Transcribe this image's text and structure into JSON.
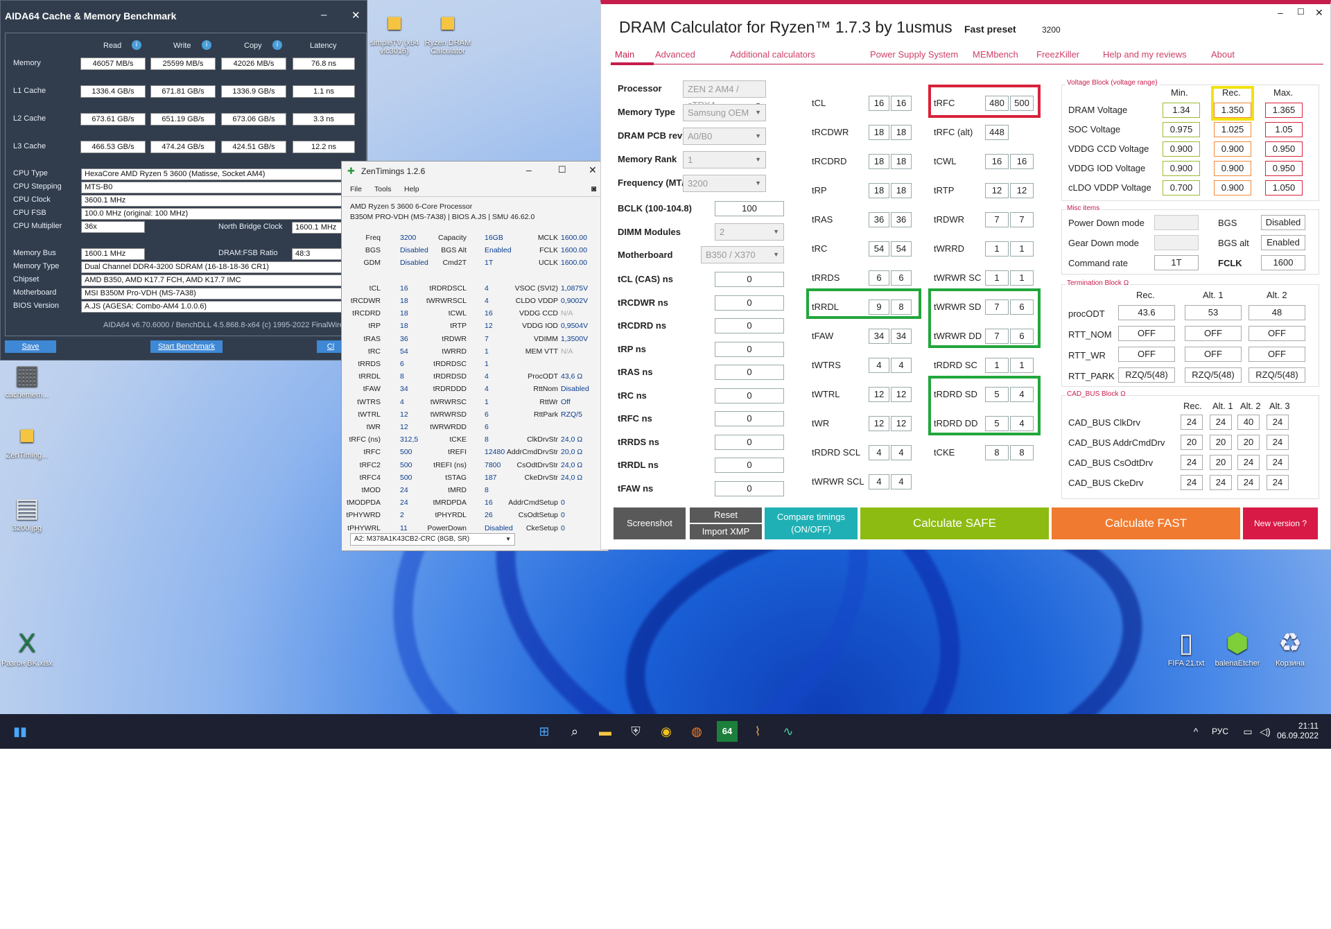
{
  "desktop": {
    "icons_top": [
      {
        "label": "simpleTV (x64 vlc3016)"
      },
      {
        "label": "Ryzen DRAM Calculator"
      }
    ],
    "icons_left": [
      {
        "label": "cachemem..."
      },
      {
        "label": "ZenTiming..."
      },
      {
        "label": "3200.jpg"
      },
      {
        "label": "Разгон BK.xlsx"
      }
    ],
    "icons_right": [
      {
        "label": "FIFA 21.txt"
      },
      {
        "label": "balenaEtcher"
      },
      {
        "label": "Корзина"
      }
    ]
  },
  "taskbar": {
    "lang": "РУС",
    "time": "21:11",
    "date": "06.09.2022",
    "icons": [
      "start-icon",
      "search-icon",
      "explorer-icon",
      "wot-icon",
      "chrome-icon",
      "firefox-icon",
      "aida64-icon",
      "sound-wave-icon",
      "monitor-app-icon"
    ],
    "aida_badge": "64"
  },
  "aida": {
    "title": "AIDA64 Cache & Memory Benchmark",
    "cols": [
      "Read",
      "Write",
      "Copy",
      "Latency"
    ],
    "rows": [
      {
        "label": "Memory",
        "values": [
          "46057 MB/s",
          "25599 MB/s",
          "42026 MB/s",
          "76.8 ns"
        ]
      },
      {
        "label": "L1 Cache",
        "values": [
          "1336.4 GB/s",
          "671.81 GB/s",
          "1336.9 GB/s",
          "1.1 ns"
        ]
      },
      {
        "label": "L2 Cache",
        "values": [
          "673.61 GB/s",
          "651.19 GB/s",
          "673.06 GB/s",
          "3.3 ns"
        ]
      },
      {
        "label": "L3 Cache",
        "values": [
          "466.53 GB/s",
          "474.24 GB/s",
          "424.51 GB/s",
          "12.2 ns"
        ]
      }
    ],
    "info": [
      {
        "label": "CPU Type",
        "value": "HexaCore AMD Ryzen 5 3600  (Matisse, Socket AM4)"
      },
      {
        "label": "CPU Stepping",
        "value": "MTS-B0"
      },
      {
        "label": "CPU Clock",
        "value": "3600.1 MHz"
      },
      {
        "label": "CPU FSB",
        "value": "100.0 MHz  (original: 100 MHz)"
      },
      {
        "label": "CPU Multiplier",
        "value": "36x"
      }
    ],
    "nb_clock_label": "North Bridge Clock",
    "nb_clock_value": "1600.1 MHz",
    "mem_info": [
      {
        "label": "Memory Bus",
        "value": "1600.1 MHz"
      },
      {
        "label": "Memory Type",
        "value": "Dual Channel DDR4-3200 SDRAM  (16-18-18-36 CR1)"
      },
      {
        "label": "Chipset",
        "value": "AMD B350, AMD K17.7 FCH, AMD K17.7 IMC"
      },
      {
        "label": "Motherboard",
        "value": "MSI B350M Pro-VDH (MS-7A38)"
      },
      {
        "label": "BIOS Version",
        "value": "A.JS  (AGESA: Combo-AM4 1.0.0.6)"
      }
    ],
    "fsb_ratio_label": "DRAM:FSB Ratio",
    "fsb_ratio_value": "48:3",
    "footer": "AIDA64 v6.70.6000 / BenchDLL 4.5.868.8-x64  (c) 1995-2022 FinalWire",
    "btn_save": "Save",
    "btn_start": "Start Benchmark",
    "btn_close": "Cl"
  },
  "zen": {
    "title": "ZenTimings 1.2.6",
    "menu": [
      "File",
      "Tools",
      "Help"
    ],
    "cpu": "AMD Ryzen 5 3600 6-Core Processor",
    "board": "B350M PRO-VDH (MS-7A38) | BIOS A.JS | SMU 46.62.0",
    "col1": [
      [
        "Freq",
        "3200"
      ],
      [
        "BGS",
        "Disabled"
      ],
      [
        "GDM",
        "Disabled"
      ],
      [
        "",
        ""
      ],
      [
        "tCL",
        "16"
      ],
      [
        "tRCDWR",
        "18"
      ],
      [
        "tRCDRD",
        "18"
      ],
      [
        "tRP",
        "18"
      ],
      [
        "tRAS",
        "36"
      ],
      [
        "tRC",
        "54"
      ],
      [
        "tRRDS",
        "6"
      ],
      [
        "tRRDL",
        "8"
      ],
      [
        "tFAW",
        "34"
      ],
      [
        "tWTRS",
        "4"
      ],
      [
        "tWTRL",
        "12"
      ],
      [
        "tWR",
        "12"
      ],
      [
        "tRFC (ns)",
        "312,5"
      ],
      [
        "tRFC",
        "500"
      ],
      [
        "tRFC2",
        "500"
      ],
      [
        "tRFC4",
        "500"
      ],
      [
        "tMOD",
        "24"
      ],
      [
        "tMODPDA",
        "24"
      ],
      [
        "tPHYWRD",
        "2"
      ],
      [
        "tPHYWRL",
        "11"
      ]
    ],
    "col2": [
      [
        "Capacity",
        "16GB"
      ],
      [
        "BGS Alt",
        "Enabled"
      ],
      [
        "Cmd2T",
        "1T"
      ],
      [
        "",
        ""
      ],
      [
        "tRDRDSCL",
        "4"
      ],
      [
        "tWRWRSCL",
        "4"
      ],
      [
        "tCWL",
        "16"
      ],
      [
        "tRTP",
        "12"
      ],
      [
        "tRDWR",
        "7"
      ],
      [
        "tWRRD",
        "1"
      ],
      [
        "tRDRDSC",
        "1"
      ],
      [
        "tRDRDSD",
        "4"
      ],
      [
        "tRDRDDD",
        "4"
      ],
      [
        "tWRWRSC",
        "1"
      ],
      [
        "tWRWRSD",
        "6"
      ],
      [
        "tWRWRDD",
        "6"
      ],
      [
        "tCKE",
        "8"
      ],
      [
        "tREFI",
        "12480"
      ],
      [
        "tREFI (ns)",
        "7800"
      ],
      [
        "tSTAG",
        "187"
      ],
      [
        "tMRD",
        "8"
      ],
      [
        "tMRDPDA",
        "16"
      ],
      [
        "tPHYRDL",
        "26"
      ],
      [
        "PowerDown",
        "Disabled"
      ]
    ],
    "col3": [
      [
        "MCLK",
        "1600.00"
      ],
      [
        "FCLK",
        "1600.00"
      ],
      [
        "UCLK",
        "1600.00"
      ],
      [
        "",
        ""
      ],
      [
        "VSOC (SVI2)",
        "1,0875V"
      ],
      [
        "CLDO VDDP",
        "0,9002V"
      ],
      [
        "VDDG CCD",
        "N/A"
      ],
      [
        "VDDG IOD",
        "0,9504V"
      ],
      [
        "VDIMM",
        "1,3500V"
      ],
      [
        "MEM VTT",
        "N/A"
      ],
      [
        "",
        ""
      ],
      [
        "ProcODT",
        "43,6 Ω"
      ],
      [
        "RttNom",
        "Disabled"
      ],
      [
        "RttWr",
        "Off"
      ],
      [
        "RttPark",
        "RZQ/5"
      ],
      [
        "",
        ""
      ],
      [
        "ClkDrvStr",
        "24,0 Ω"
      ],
      [
        "AddrCmdDrvStr",
        "20,0 Ω"
      ],
      [
        "CsOdtDrvStr",
        "24,0 Ω"
      ],
      [
        "CkeDrvStr",
        "24,0 Ω"
      ],
      [
        "",
        ""
      ],
      [
        "AddrCmdSetup",
        "0"
      ],
      [
        "CsOdtSetup",
        "0"
      ],
      [
        "CkeSetup",
        "0"
      ]
    ],
    "dimm": "A2: M378A1K43CB2-CRC (8GB, SR)"
  },
  "dram": {
    "title": "DRAM Calculator for Ryzen™ 1.7.3 by 1usmus",
    "fast_preset_label": "Fast preset",
    "fast_preset_value": "3200",
    "tabs": [
      "Main",
      "Advanced",
      "Additional calculators",
      "Power Supply System",
      "MEMbench",
      "FreezKiller",
      "Help and my reviews",
      "About"
    ],
    "left_selects": [
      {
        "label": "Processor",
        "value": "ZEN 2 AM4 / sTRX4"
      },
      {
        "label": "Memory Type",
        "value": "Samsung OEM"
      },
      {
        "label": "DRAM PCB revision",
        "value": "A0/B0"
      },
      {
        "label": "Memory Rank",
        "value": "1"
      },
      {
        "label": "Frequency (MT/s)",
        "value": "3200"
      }
    ],
    "bclk_label": "BCLK (100-104.8)",
    "bclk_value": "100",
    "dimm_label": "DIMM Modules",
    "dimm_value": "2",
    "mb_label": "Motherboard",
    "mb_value": "B350 / X370",
    "ns_fields": [
      {
        "label": "tCL (CAS) ns",
        "value": "0"
      },
      {
        "label": "tRCDWR ns",
        "value": "0"
      },
      {
        "label": "tRCDRD ns",
        "value": "0"
      },
      {
        "label": "tRP ns",
        "value": "0"
      },
      {
        "label": "tRAS ns",
        "value": "0"
      },
      {
        "label": "tRC ns",
        "value": "0"
      },
      {
        "label": "tRFC ns",
        "value": "0"
      },
      {
        "label": "tRRDS ns",
        "value": "0"
      },
      {
        "label": "tRRDL ns",
        "value": "0"
      },
      {
        "label": "tFAW ns",
        "value": "0"
      }
    ],
    "timings_a": [
      {
        "label": "tCL",
        "v1": "16",
        "v2": "16"
      },
      {
        "label": "tRCDWR",
        "v1": "18",
        "v2": "18"
      },
      {
        "label": "tRCDRD",
        "v1": "18",
        "v2": "18"
      },
      {
        "label": "tRP",
        "v1": "18",
        "v2": "18"
      },
      {
        "label": "tRAS",
        "v1": "36",
        "v2": "36"
      },
      {
        "label": "tRC",
        "v1": "54",
        "v2": "54"
      },
      {
        "label": "tRRDS",
        "v1": "6",
        "v2": "6"
      },
      {
        "label": "tRRDL",
        "v1": "9",
        "v2": "8"
      },
      {
        "label": "tFAW",
        "v1": "34",
        "v2": "34"
      },
      {
        "label": "tWTRS",
        "v1": "4",
        "v2": "4"
      },
      {
        "label": "tWTRL",
        "v1": "12",
        "v2": "12"
      },
      {
        "label": "tWR",
        "v1": "12",
        "v2": "12"
      },
      {
        "label": "tRDRD SCL",
        "v1": "4",
        "v2": "4"
      },
      {
        "label": "tWRWR SCL",
        "v1": "4",
        "v2": "4"
      }
    ],
    "timings_b": [
      {
        "label": "tRFC",
        "v1": "480",
        "v2": "500"
      },
      {
        "label": "tRFC (alt)",
        "v1": "448",
        "v2": ""
      },
      {
        "label": "tCWL",
        "v1": "16",
        "v2": "16"
      },
      {
        "label": "tRTP",
        "v1": "12",
        "v2": "12"
      },
      {
        "label": "tRDWR",
        "v1": "7",
        "v2": "7"
      },
      {
        "label": "tWRRD",
        "v1": "1",
        "v2": "1"
      },
      {
        "label": "tWRWR SC",
        "v1": "1",
        "v2": "1"
      },
      {
        "label": "tWRWR SD",
        "v1": "7",
        "v2": "6"
      },
      {
        "label": "tWRWR DD",
        "v1": "7",
        "v2": "6"
      },
      {
        "label": "tRDRD SC",
        "v1": "1",
        "v2": "1"
      },
      {
        "label": "tRDRD SD",
        "v1": "5",
        "v2": "4"
      },
      {
        "label": "tRDRD DD",
        "v1": "5",
        "v2": "4"
      },
      {
        "label": "tCKE",
        "v1": "8",
        "v2": "8"
      }
    ],
    "voltage": {
      "title": "Voltage Block (voltage range)",
      "cols": [
        "Min.",
        "Rec.",
        "Max."
      ],
      "rows": [
        {
          "label": "DRAM Voltage",
          "min": "1.34",
          "rec": "1.350",
          "max": "1.365"
        },
        {
          "label": "SOC Voltage",
          "min": "0.975",
          "rec": "1.025",
          "max": "1.05"
        },
        {
          "label": "VDDG  CCD Voltage",
          "min": "0.900",
          "rec": "0.900",
          "max": "0.950"
        },
        {
          "label": "VDDG  IOD Voltage",
          "min": "0.900",
          "rec": "0.900",
          "max": "0.950"
        },
        {
          "label": "cLDO VDDP Voltage",
          "min": "0.700",
          "rec": "0.900",
          "max": "1.050"
        }
      ],
      "colors": {
        "min": "#9bbb2e",
        "rec": "#f08a3a",
        "max": "#d8223a"
      }
    },
    "misc": {
      "title": "Misc items",
      "power_down_label": "Power Down mode",
      "gear_down_label": "Gear Down mode",
      "command_rate_label": "Command rate",
      "command_rate_value": "1T",
      "bgs_label": "BGS",
      "bgs_value": "Disabled",
      "bgs_alt_label": "BGS alt",
      "bgs_alt_value": "Enabled",
      "fclk_label": "FCLK",
      "fclk_value": "1600"
    },
    "termination": {
      "title": "Termination Block Ω",
      "cols": [
        "Rec.",
        "Alt. 1",
        "Alt. 2"
      ],
      "rows": [
        {
          "label": "procODT",
          "vals": [
            "43.6",
            "53",
            "48"
          ]
        },
        {
          "label": "RTT_NOM",
          "vals": [
            "OFF",
            "OFF",
            "OFF"
          ]
        },
        {
          "label": "RTT_WR",
          "vals": [
            "OFF",
            "OFF",
            "OFF"
          ]
        },
        {
          "label": "RTT_PARK",
          "vals": [
            "RZQ/5(48)",
            "RZQ/5(48)",
            "RZQ/5(48)"
          ]
        }
      ]
    },
    "cadbus": {
      "title": "CAD_BUS Block Ω",
      "cols": [
        "Rec.",
        "Alt. 1",
        "Alt. 2",
        "Alt. 3"
      ],
      "rows": [
        {
          "label": "CAD_BUS ClkDrv",
          "vals": [
            "24",
            "24",
            "40",
            "24"
          ]
        },
        {
          "label": "CAD_BUS AddrCmdDrv",
          "vals": [
            "20",
            "20",
            "20",
            "24"
          ]
        },
        {
          "label": "CAD_BUS CsOdtDrv",
          "vals": [
            "24",
            "20",
            "24",
            "24"
          ]
        },
        {
          "label": "CAD_BUS CkeDrv",
          "vals": [
            "24",
            "24",
            "24",
            "24"
          ]
        }
      ]
    },
    "buttons": {
      "screenshot": "Screenshot",
      "reset": "Reset",
      "import_xmp": "Import XMP",
      "compare": "Compare timings (ON/OFF)",
      "safe": "Calculate SAFE",
      "fast": "Calculate FAST",
      "new_version": "New version ?"
    },
    "button_colors": {
      "screenshot": "#595959",
      "compare": "#1fb0b5",
      "safe": "#8dbb12",
      "fast": "#f07b30",
      "new_version": "#d81a46"
    }
  }
}
